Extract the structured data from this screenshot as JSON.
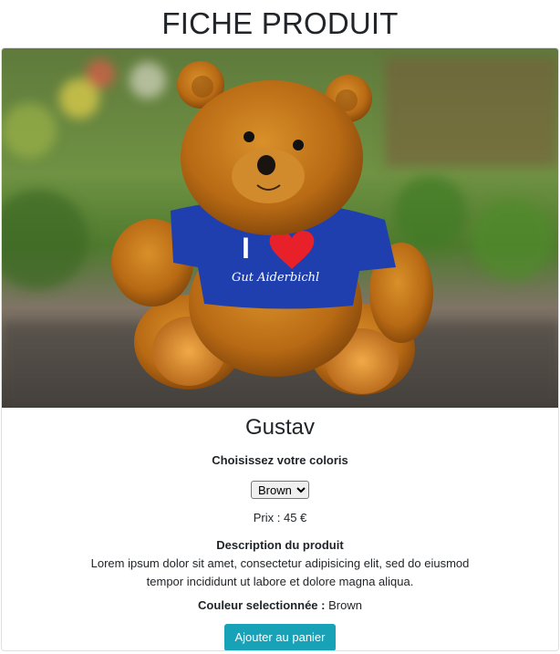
{
  "page": {
    "title": "FICHE PRODUIT"
  },
  "product": {
    "name": "Gustav",
    "image": {
      "icon": "teddy-bear-photo",
      "shirt_text": "Gut Aiderbichl"
    },
    "color_prompt": "Choisissez votre coloris",
    "color_select": {
      "selected": "Brown"
    },
    "price_text": "Prix : 45 €",
    "description_title": "Description du produit",
    "description": "Lorem ipsum dolor sit amet, consectetur adipisicing elit, sed do eiusmod tempor incididunt ut labore et dolore magna aliqua.",
    "selected_color_label": "Couleur selectionnée :",
    "selected_color_value": "Brown",
    "add_to_cart_label": "Ajouter au panier"
  },
  "colors": {
    "button": "#17a2b8",
    "text": "#212529",
    "heart": "#e8202a",
    "shirt": "#1f3fae"
  }
}
